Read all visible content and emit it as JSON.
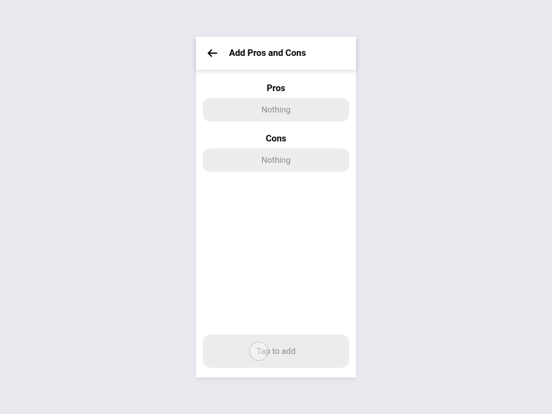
{
  "appbar": {
    "title": "Add Pros and Cons"
  },
  "sections": {
    "pros": {
      "label": "Pros",
      "empty_text": "Nothing"
    },
    "cons": {
      "label": "Cons",
      "empty_text": "Nothing"
    }
  },
  "add_button": {
    "label": "Tap to add"
  }
}
